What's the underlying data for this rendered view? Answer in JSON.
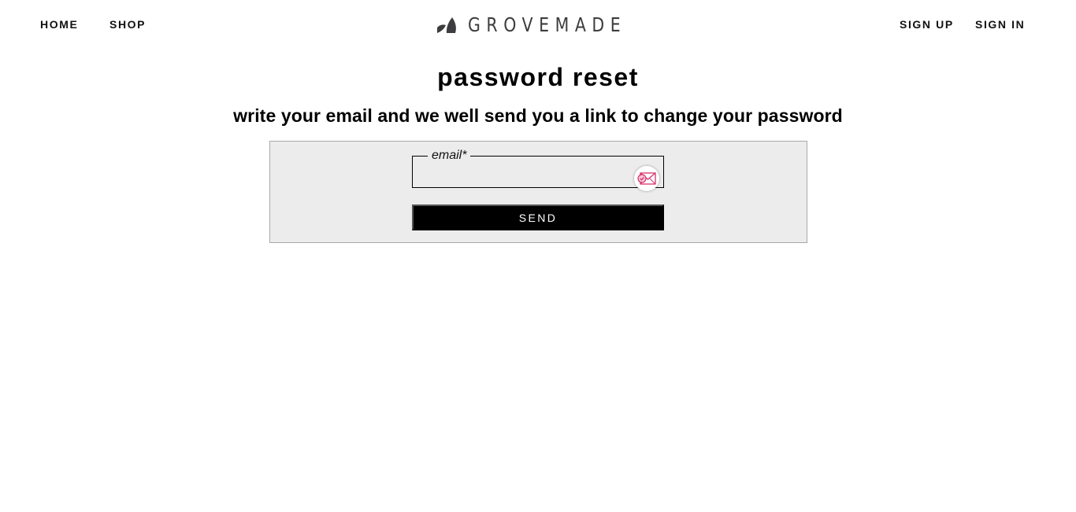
{
  "nav": {
    "home_label": "HOME",
    "shop_label": "SHOP",
    "signup_label": "SIGN UP",
    "signin_label": "SIGN IN"
  },
  "logo": {
    "text": "GROVEMADE",
    "icon": "grovemade-leaf-icon"
  },
  "page": {
    "title": "password reset",
    "subtitle": "write your email and we well send you a link to change your password"
  },
  "form": {
    "email_legend": "email*",
    "email_value": "",
    "email_autofill_icon": "mail-extension-icon",
    "send_label": "SEND"
  },
  "colors": {
    "panel_bg": "#ececec",
    "panel_border": "#a9a9a9",
    "button_bg": "#000000",
    "logo_color": "#3d3d3f",
    "extension_icon_accent": "#d6336c"
  }
}
